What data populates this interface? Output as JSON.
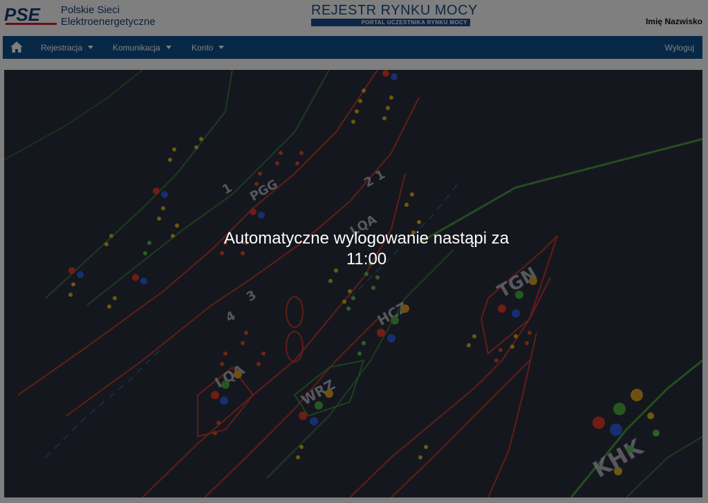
{
  "header": {
    "company_line1": "Polskie Sieci",
    "company_line2": "Elektroenergetyczne",
    "registry_title": "REJESTR RYNKU MOCY",
    "registry_subtitle": "PORTAL UCZESTNIKA RYNKU MOCY",
    "user_name": "Imię Nazwisko",
    "logo_icon": "pse-logo"
  },
  "nav": {
    "home_icon": "home-icon",
    "items": [
      {
        "label": "Rejestracja"
      },
      {
        "label": "Komunikacja"
      },
      {
        "label": "Konto"
      }
    ],
    "logout": "Wyloguj"
  },
  "hero": {
    "labels": [
      "TGN",
      "KHK",
      "HCZ",
      "WRZ",
      "LQA",
      "PGG",
      "LQA",
      "4",
      "3",
      "1",
      "2 1"
    ]
  },
  "overlay": {
    "message_line1": "Automatyczne wylogowanie nastąpi za",
    "countdown": "11:00"
  },
  "colors": {
    "nav_background": "#0e4f8f",
    "brand_blue": "#1a4a8f",
    "overlay_dim": "rgba(0,0,0,0.5)"
  }
}
